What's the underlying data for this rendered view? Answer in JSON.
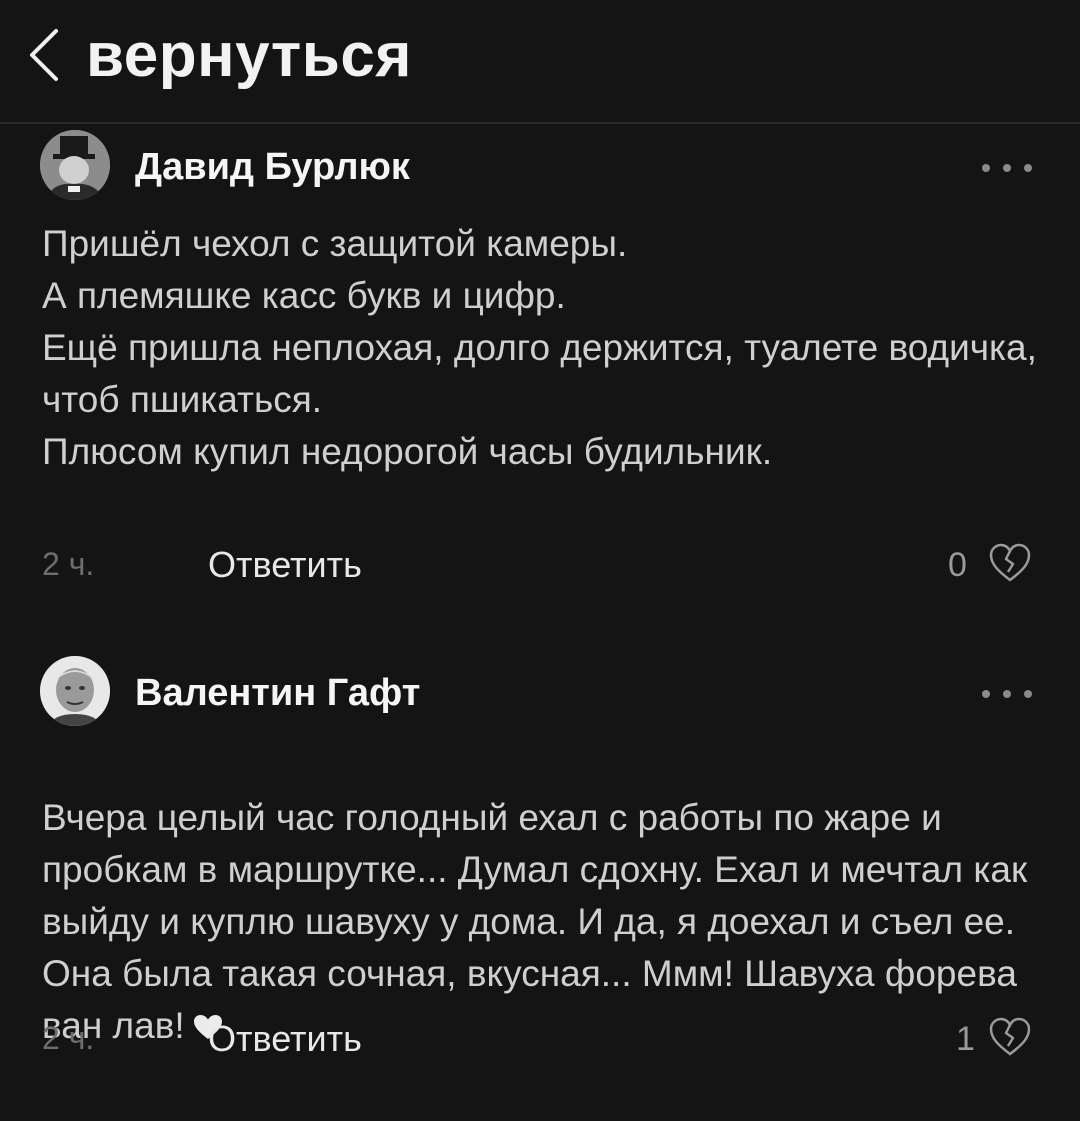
{
  "header": {
    "back_label": "вернуться"
  },
  "comments": [
    {
      "author": "Давид Бурлюк",
      "text": "Пришёл чехол с защитой камеры.\nА племяшке касс букв и цифр.\nЕщё пришла неплохая, долго держится, туалете водичка, чтоб пшикаться.\nПлюсом купил недорогой часы будильник.",
      "time": "2 ч.",
      "reply_label": "Ответить",
      "likes": "0",
      "avatar_icon": "avatar-top-hat-portrait",
      "like_icon": "broken-heart-icon"
    },
    {
      "author": "Валентин Гафт",
      "text": "Вчера целый час голодный ехал с работы по жаре и пробкам в маршрутке... Думал сдохну. Ехал и мечтал как выйду и куплю шавуху у дома. И да, я доехал и съел ее. Она была такая сочная, вкусная... Ммм! Шавуха форева ван лав!",
      "time": "2 ч.",
      "reply_label": "Ответить",
      "likes": "1",
      "avatar_icon": "avatar-portrait",
      "like_icon": "broken-heart-icon",
      "emoji": "heart-emoji"
    }
  ],
  "colors": {
    "background": "#141414",
    "text_primary": "#f5f5f5",
    "text_body": "#cfcfcf",
    "text_muted": "#6e6e6e"
  }
}
